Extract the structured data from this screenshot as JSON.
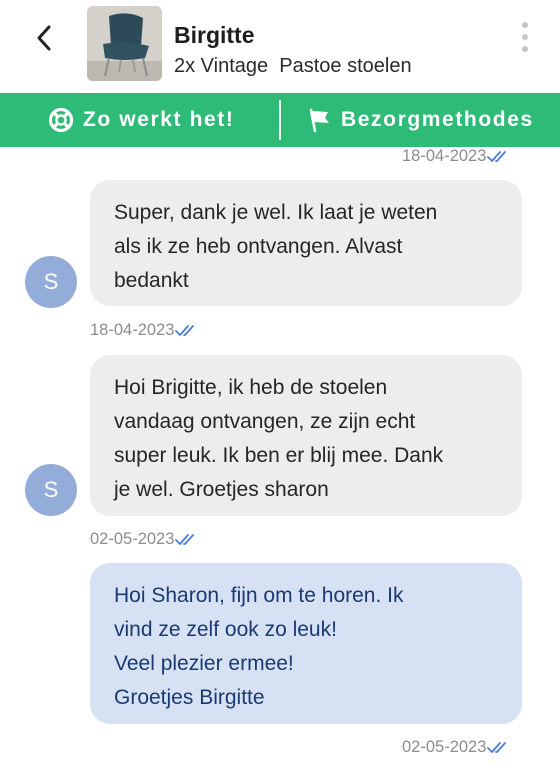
{
  "header": {
    "back_icon": "chevron-left-icon",
    "thumbnail_icon": "chair-thumbnail",
    "contact_name": "Birgitte",
    "listing_title": "2x Vintage  Pastoe stoelen",
    "menu_icon": "more-vertical-icon"
  },
  "action_bar": {
    "background": "#2ebb78",
    "how_it_works_label": "Zo werkt het!",
    "how_it_works_icon": "lifebuoy-icon",
    "delivery_label": "Bezorgmethodes",
    "delivery_icon": "delivery-flag-icon"
  },
  "messages": [
    {
      "kind": "timestamp-only",
      "timestamp": "18-04-2023"
    },
    {
      "kind": "incoming",
      "avatar_letter": "S",
      "lines": [
        "Super, dank je wel. Ik laat je weten",
        "als ik ze heb ontvangen. Alvast",
        "bedankt"
      ],
      "timestamp": "18-04-2023"
    },
    {
      "kind": "incoming",
      "avatar_letter": "S",
      "lines": [
        "Hoi Brigitte, ik heb de stoelen",
        "vandaag ontvangen, ze zijn echt",
        "super leuk. Ik ben er blij mee. Dank",
        "je wel. Groetjes sharon"
      ],
      "timestamp": "02-05-2023"
    },
    {
      "kind": "outgoing",
      "lines": [
        "Hoi Sharon, fijn om te horen. Ik",
        "vind ze zelf ook zo leuk!",
        "Veel plezier ermee!",
        "Groetjes Birgitte"
      ],
      "timestamp": "02-05-2023"
    }
  ],
  "colors": {
    "read_receipt": "#4a7ed8",
    "incoming_bubble": "#ededed",
    "outgoing_bubble": "#d6e1f4",
    "avatar": "#93acd8"
  }
}
